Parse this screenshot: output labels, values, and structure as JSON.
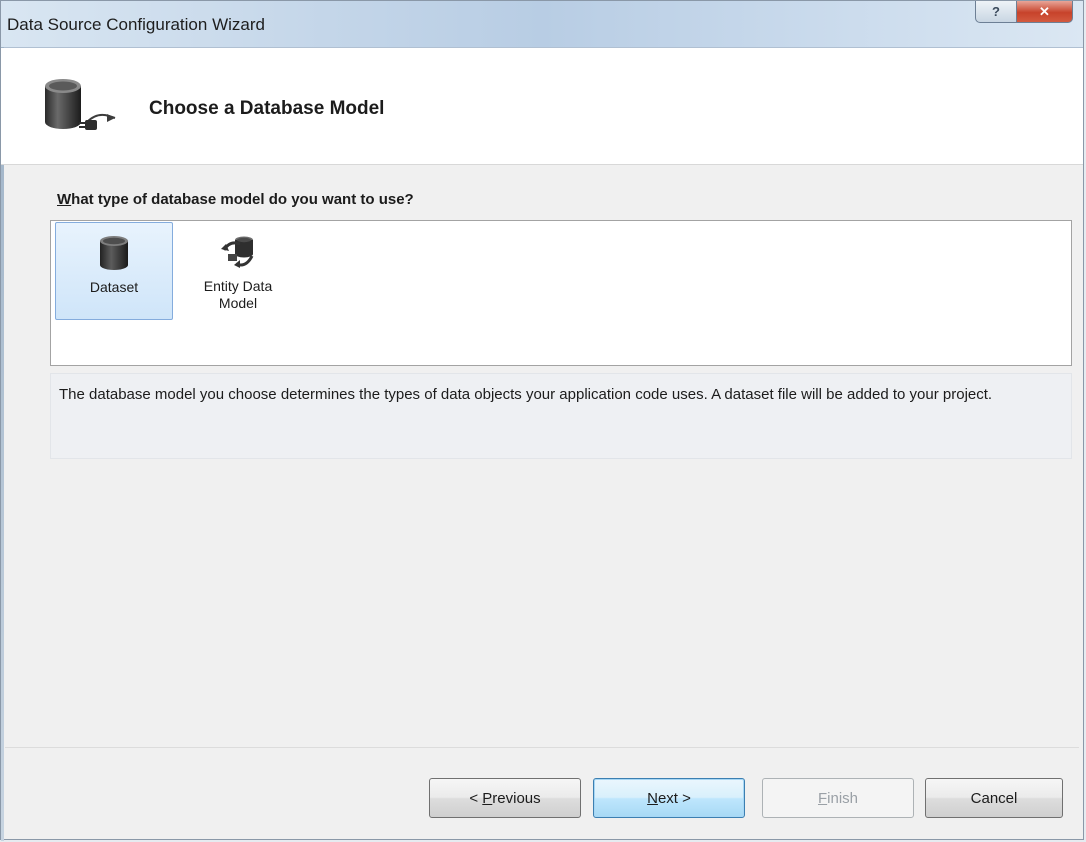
{
  "window": {
    "title": "Data Source Configuration Wizard",
    "help_symbol": "?",
    "close_symbol": "✕"
  },
  "header": {
    "title": "Choose a Database Model",
    "icon": "database-connect-icon"
  },
  "question": {
    "access_key": "W",
    "rest": "hat type of database model do you want to use?"
  },
  "models": [
    {
      "label": "Dataset",
      "icon": "database-icon",
      "selected": true
    },
    {
      "label": "Entity Data Model",
      "icon": "entity-data-model-icon",
      "selected": false
    }
  ],
  "description": "The database model you choose determines the types of data objects your application code uses. A dataset file will be added to your project.",
  "buttons": {
    "previous": {
      "prefix": "< ",
      "access_key": "P",
      "rest": "revious"
    },
    "next": {
      "access_key": "N",
      "rest": "ext >"
    },
    "finish": {
      "access_key": "F",
      "rest": "inish",
      "enabled": false
    },
    "cancel": {
      "label": "Cancel"
    }
  },
  "colors": {
    "selected_bg": "#cfe5f9",
    "selected_border": "#84acdd",
    "close_red": "#c7432b"
  }
}
